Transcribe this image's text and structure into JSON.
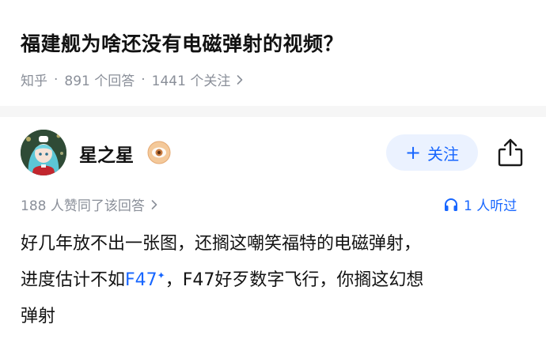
{
  "question": {
    "title": "福建舰为啥还没有电磁弹射的视频？",
    "source": "知乎",
    "answers": "891 个回答",
    "followers": "1441 个关注"
  },
  "author": {
    "name": "星之星",
    "follow_label": "关注"
  },
  "stats": {
    "likes": "188 人赞同了该回答",
    "listen": "1 人听过"
  },
  "answer": {
    "line1": "好几年放不出一张图，还搁这嘲笑福特的电磁弹射，",
    "line2_pre": "进度估计不如",
    "line2_link": "F47",
    "line2_link_mark": "✦",
    "line2_post": "，F47好歹数字飞行，你搁这幻想",
    "line3": "弹射"
  },
  "colors": {
    "accent": "#1766ff",
    "meta": "#8a8f99",
    "follow_bg": "#ebf2ff"
  },
  "icons": {
    "badge": "donut-badge-icon",
    "share": "share-icon",
    "listen": "headphones-icon",
    "chevron": "chevron-right-icon"
  }
}
